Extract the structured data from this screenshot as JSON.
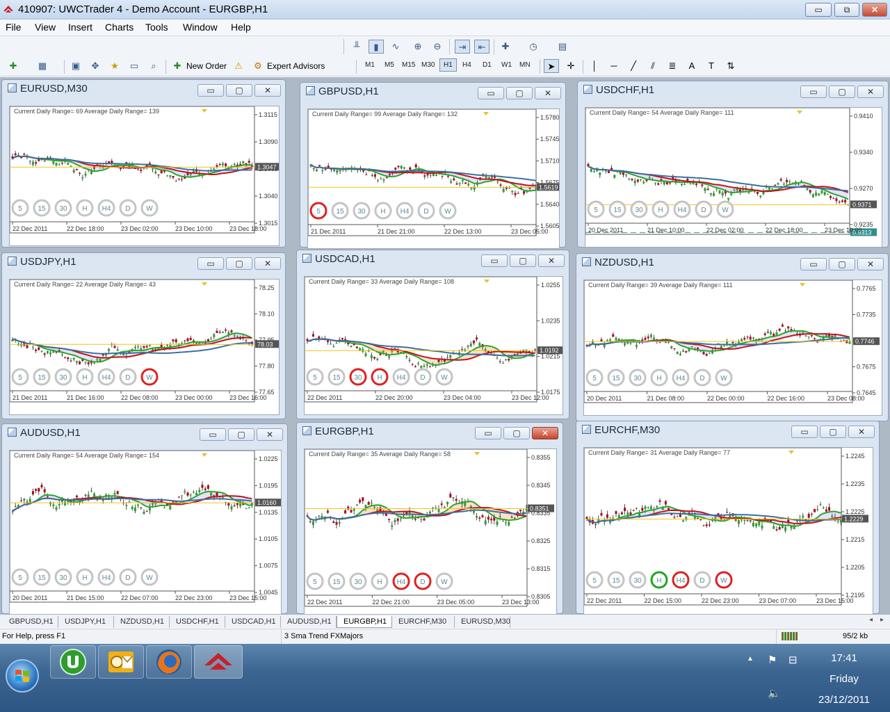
{
  "window": {
    "title": "410907: UWCTrader 4 - Demo Account - EURGBP,H1",
    "minimize": "▭",
    "restore": "⧉",
    "close": "✕"
  },
  "menu": [
    "File",
    "View",
    "Insert",
    "Charts",
    "Tools",
    "Window",
    "Help"
  ],
  "toolbar": {
    "new_order": "New Order",
    "expert_advisors": "Expert Advisors",
    "timeframes": [
      "M1",
      "M5",
      "M15",
      "M30",
      "H1",
      "H4",
      "D1",
      "W1",
      "MN"
    ],
    "active_timeframe": "H1",
    "icons": [
      "add-chart-icon",
      "profiles-icon",
      "market-watch-icon",
      "navigator-icon",
      "data-window-icon",
      "terminal-icon",
      "strategy-tester-icon",
      "warning-icon",
      "expert-advisors-icon",
      "bar-chart-icon",
      "candlestick-icon",
      "line-chart-icon",
      "zoom-in-icon",
      "zoom-out-icon",
      "autoscroll-icon",
      "chart-shift-icon",
      "indicators-icon",
      "periods-icon",
      "templates-icon",
      "cursor-icon",
      "crosshair-icon",
      "vertical-line-icon",
      "horizontal-line-icon",
      "trendline-icon",
      "fibonacci-icon",
      "text-icon",
      "label-icon",
      "arrows-icon"
    ]
  },
  "range_labels": {
    "current": "Current Daily Range=",
    "average": "Average Daily Range="
  },
  "period_buttons": [
    "5",
    "15",
    "30",
    "H",
    "H4",
    "D",
    "W"
  ],
  "charts": [
    {
      "title": "EURUSD,M30",
      "current_range": "69",
      "average_range": "139",
      "price_labels": [
        "1.3115",
        "1.3090",
        "1.3065",
        "1.3040",
        "1.3015"
      ],
      "current_price": "1.3047",
      "time_labels": [
        "22 Dec 2011",
        "22 Dec 18:00",
        "23 Dec 02:00",
        "23 Dec 10:00",
        "23 Dec 18:00"
      ],
      "highlighted": []
    },
    {
      "title": "GBPUSD,H1",
      "current_range": "99",
      "average_range": "132",
      "price_labels": [
        "1.5780",
        "1.5745",
        "1.5710",
        "1.5675",
        "1.5640",
        "1.5605"
      ],
      "current_price": "1.5619",
      "time_labels": [
        "21 Dec 2011",
        "21 Dec 21:00",
        "22 Dec 13:00",
        "23 Dec 05:00"
      ],
      "highlighted": [
        {
          "label": "5",
          "color": "#e02020"
        }
      ]
    },
    {
      "title": "USDCHF,H1",
      "current_range": "54",
      "average_range": "111",
      "price_labels": [
        "0.9410",
        "0.9340",
        "0.9270",
        "0.9235"
      ],
      "current_price": "0.9371",
      "extra_price": "0.9313",
      "time_labels": [
        "20 Dec 2011",
        "21 Dec 10:00",
        "22 Dec 02:00",
        "22 Dec 18:00",
        "23 Dec 10:00"
      ],
      "highlighted": []
    },
    {
      "title": "USDJPY,H1",
      "current_range": "22",
      "average_range": "43",
      "price_labels": [
        "78.25",
        "78.10",
        "77.95",
        "77.80",
        "77.65"
      ],
      "current_price": "78.03",
      "time_labels": [
        "21 Dec 2011",
        "21 Dec 16:00",
        "22 Dec 08:00",
        "23 Dec 00:00",
        "23 Dec 16:00"
      ],
      "highlighted": [
        {
          "label": "W",
          "color": "#e02020"
        }
      ]
    },
    {
      "title": "USDCAD,H1",
      "current_range": "33",
      "average_range": "108",
      "price_labels": [
        "1.0255",
        "1.0235",
        "1.0215",
        "1.0175"
      ],
      "current_price": "1.0192",
      "time_labels": [
        "22 Dec 2011",
        "22 Dec 20:00",
        "23 Dec 04:00",
        "23 Dec 12:00"
      ],
      "highlighted": [
        {
          "label": "30",
          "color": "#e02020"
        },
        {
          "label": "H",
          "color": "#e02020"
        }
      ]
    },
    {
      "title": "NZDUSD,H1",
      "current_range": "39",
      "average_range": "111",
      "price_labels": [
        "0.7765",
        "0.7735",
        "0.7705",
        "0.7675",
        "0.7645"
      ],
      "current_price": "0.7746",
      "time_labels": [
        "20 Dec 2011",
        "21 Dec 08:00",
        "22 Dec 00:00",
        "22 Dec 16:00",
        "23 Dec 08:00"
      ],
      "highlighted": []
    },
    {
      "title": "AUDUSD,H1",
      "current_range": "54",
      "average_range": "154",
      "price_labels": [
        "1.0225",
        "1.0195",
        "1.0135",
        "1.0105",
        "1.0075",
        "1.0045"
      ],
      "current_price": "1.0160",
      "time_labels": [
        "20 Dec 2011",
        "21 Dec 15:00",
        "22 Dec 07:00",
        "22 Dec 23:00",
        "23 Dec 15:00"
      ],
      "highlighted": []
    },
    {
      "title": "EURGBP,H1",
      "current_range": "35",
      "average_range": "58",
      "price_labels": [
        "0.8355",
        "0.8345",
        "0.8335",
        "0.8325",
        "0.8315",
        "0.8305"
      ],
      "current_price": "0.8351",
      "time_labels": [
        "22 Dec 2011",
        "22 Dec 21:00",
        "23 Dec 05:00",
        "23 Dec 13:00"
      ],
      "highlighted": [
        {
          "label": "H4",
          "color": "#e02020"
        },
        {
          "label": "D",
          "color": "#e02020"
        }
      ]
    },
    {
      "title": "EURCHF,M30",
      "current_range": "31",
      "average_range": "77",
      "price_labels": [
        "1.2245",
        "1.2235",
        "1.2225",
        "1.2215",
        "1.2205",
        "1.2195"
      ],
      "current_price": "1.2229",
      "time_labels": [
        "22 Dec 2011",
        "22 Dec 15:00",
        "22 Dec 23:00",
        "23 Dec 07:00",
        "23 Dec 15:00"
      ],
      "highlighted": [
        {
          "label": "H",
          "color": "#1fa51f"
        },
        {
          "label": "H4",
          "color": "#e02020"
        },
        {
          "label": "W",
          "color": "#e02020"
        }
      ]
    }
  ],
  "tabs": [
    "GBPUSD,H1",
    "USDJPY,H1",
    "NZDUSD,H1",
    "USDCHF,H1",
    "USDCAD,H1",
    "AUDUSD,H1",
    "EURGBP,H1",
    "EURCHF,M30",
    "EURUSD,M30"
  ],
  "active_tab": "EURGBP,H1",
  "status": {
    "help": "For Help, press F1",
    "profile": "3 Sma Trend FXMajors",
    "traffic": "95/2 kb"
  },
  "taskbar": {
    "time": "17:41",
    "day": "Friday",
    "date": "23/12/2011",
    "apps": [
      "utorrent-icon",
      "outlook-icon",
      "firefox-icon",
      "uwctrader-icon"
    ]
  },
  "colors": {
    "bull_candle": "#2ca02c",
    "bear_candle": "#b00020",
    "ma_fast": "#2aa52a",
    "ma_mid": "#c0141c",
    "ma_slow": "#3a6fa0",
    "current_line": "#f0c419",
    "highlight_red": "#e02020",
    "highlight_green": "#1fa51f"
  }
}
